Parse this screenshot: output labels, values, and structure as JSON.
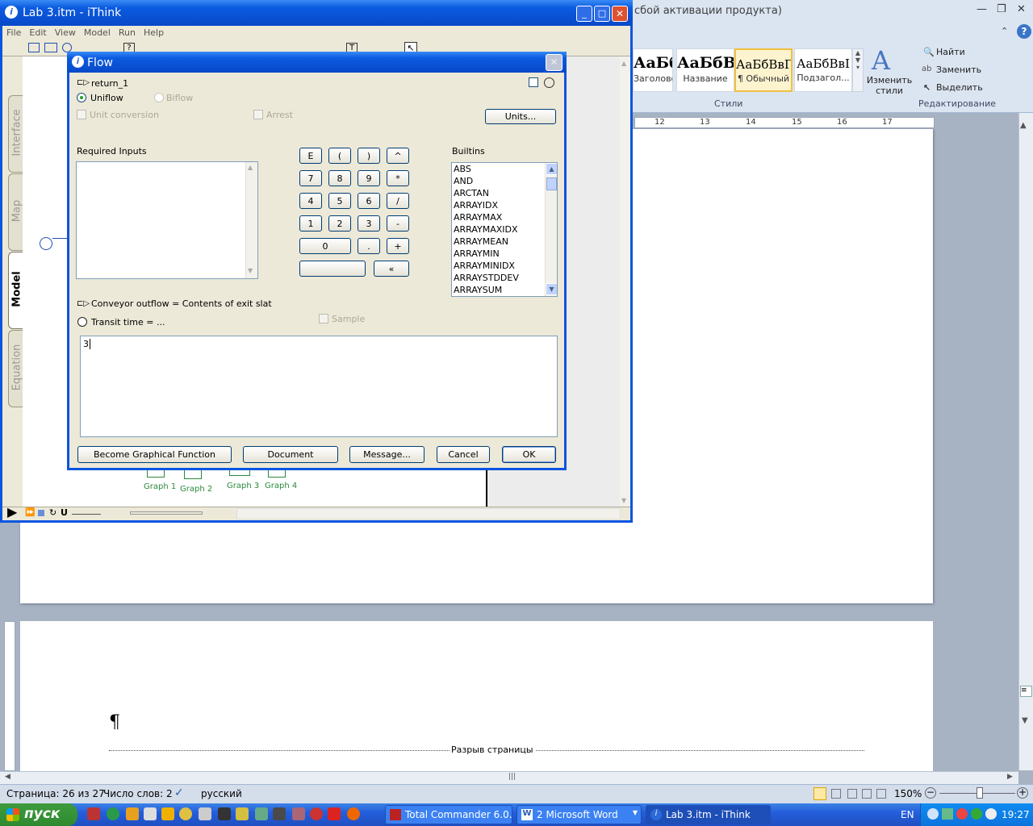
{
  "word": {
    "title_fragment": "сбой активации продукта)",
    "styles": [
      {
        "preview": "АаБбВ",
        "name": "Заголово..."
      },
      {
        "preview": "АаБбВ",
        "name": "Название"
      },
      {
        "preview": "АаБбВвГ",
        "name": "¶ Обычный"
      },
      {
        "preview": "АаБбВвІ",
        "name": "Подзагол..."
      }
    ],
    "change_styles": "Изменить стили",
    "styles_group": "Стили",
    "find": "Найти",
    "replace": "Заменить",
    "select": "Выделить",
    "editing_group": "Редактирование",
    "ruler_marks": [
      "12",
      "13",
      "14",
      "15",
      "16",
      "17"
    ],
    "paragraph_mark": "¶",
    "page_break": "Разрыв страницы",
    "status": {
      "page": "Страница: 26 из 27",
      "words": "Число слов: 2",
      "language": "русский",
      "zoom": "150%"
    }
  },
  "taskbar": {
    "start": "пуск",
    "tasks": [
      "Total Commander 6.0...",
      "2 Microsoft Word",
      "Lab 3.itm - iThink"
    ],
    "lang": "EN",
    "clock": "19:27"
  },
  "ithink": {
    "title": "Lab 3.itm - iThink",
    "menu": [
      "File",
      "Edit",
      "View",
      "Model",
      "Run",
      "Help"
    ],
    "tabs": [
      "Interface",
      "Map",
      "Model",
      "Equation"
    ],
    "graphs": [
      "Graph 1",
      "Graph 2",
      "Graph 3",
      "Graph 4"
    ]
  },
  "flow": {
    "title": "Flow",
    "name": "return_1",
    "uniflow": "Uniflow",
    "biflow": "Biflow",
    "unit_conversion": "Unit conversion",
    "arrest": "Arrest",
    "units_button": "Units...",
    "required_inputs": "Required Inputs",
    "builtins_label": "Builtins",
    "keypad": [
      [
        "E",
        "(",
        ")",
        "^"
      ],
      [
        "7",
        "8",
        "9",
        "*"
      ],
      [
        "4",
        "5",
        "6",
        "/"
      ],
      [
        "1",
        "2",
        "3",
        "-"
      ]
    ],
    "key_zero": "0",
    "key_dot": ".",
    "key_plus": "+",
    "key_back": "«",
    "builtins": [
      "ABS",
      "AND",
      "ARCTAN",
      "ARRAYIDX",
      "ARRAYMAX",
      "ARRAYMAXIDX",
      "ARRAYMEAN",
      "ARRAYMIN",
      "ARRAYMINIDX",
      "ARRAYSTDDEV",
      "ARRAYSUM"
    ],
    "conveyor_outflow": "Conveyor outflow = Contents of exit slat",
    "transit_time": "Transit time = ...",
    "sample": "Sample",
    "equation": "3",
    "buttons": {
      "graphical": "Become Graphical Function",
      "document": "Document",
      "message": "Message...",
      "cancel": "Cancel",
      "ok": "OK"
    }
  }
}
